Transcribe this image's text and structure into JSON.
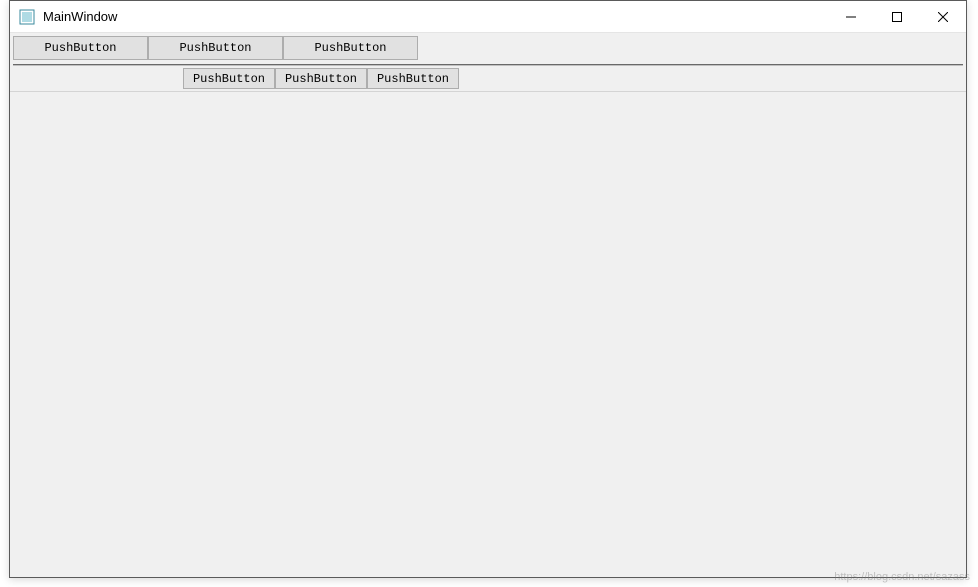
{
  "window": {
    "title": "MainWindow"
  },
  "toolbar1": {
    "buttons": [
      {
        "label": "PushButton"
      },
      {
        "label": "PushButton"
      },
      {
        "label": "PushButton"
      }
    ]
  },
  "toolbar2": {
    "buttons": [
      {
        "label": "PushButton"
      },
      {
        "label": "PushButton"
      },
      {
        "label": "PushButton"
      }
    ]
  },
  "watermark": "https://blog.csdn.net/sazass"
}
